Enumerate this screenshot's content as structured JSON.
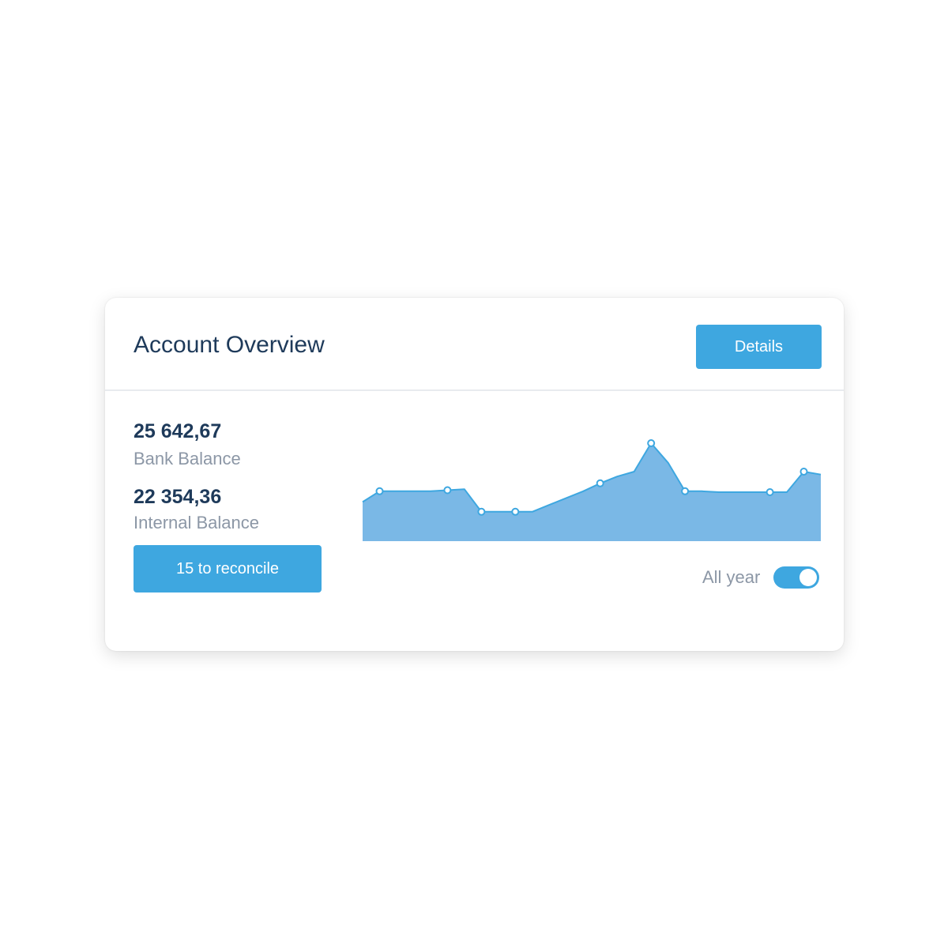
{
  "card": {
    "title": "Account Overview",
    "details_label": "Details"
  },
  "balances": {
    "bank_value": "25 642,67",
    "bank_label": "Bank Balance",
    "internal_value": "22 354,36",
    "internal_label": "Internal Balance"
  },
  "reconcile_label": "15 to reconcile",
  "toggle": {
    "label": "All year",
    "on": true
  },
  "colors": {
    "accent": "#3ea7e0",
    "chart_fill": "#7ab8e6",
    "title_text": "#1e3a5a",
    "muted_text": "#8c97a6"
  },
  "chart_data": {
    "type": "area",
    "title": "",
    "xlabel": "",
    "ylabel": "",
    "ylim": [
      0,
      100
    ],
    "grid": false,
    "legend": "none",
    "x": [
      0,
      1,
      2,
      3,
      4,
      5,
      6,
      7,
      8,
      9,
      10,
      11,
      12,
      13,
      14,
      15,
      16,
      17,
      18,
      19,
      20,
      21,
      22,
      23,
      24,
      25,
      26,
      27
    ],
    "values": [
      40,
      51,
      51,
      51,
      51,
      52,
      53,
      30,
      30,
      30,
      30,
      37,
      44,
      51,
      59,
      66,
      71,
      100,
      80,
      51,
      51,
      50,
      50,
      50,
      50,
      50,
      71,
      68
    ],
    "markers": [
      1,
      5,
      7,
      9,
      14,
      17,
      19,
      24,
      26
    ]
  }
}
